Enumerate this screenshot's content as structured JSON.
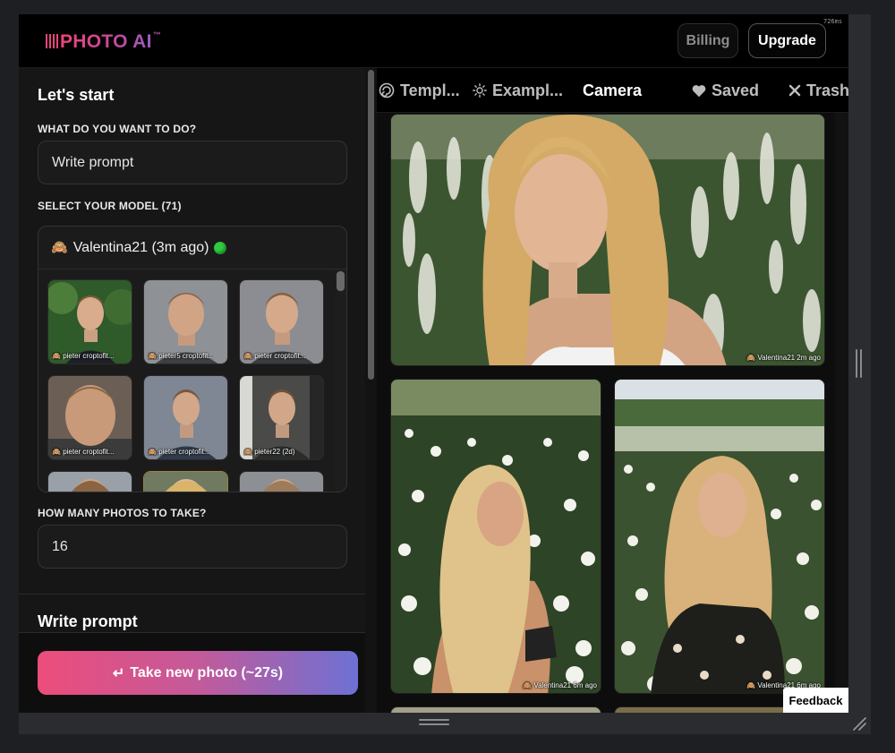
{
  "header": {
    "logo_text": "PHOTO AI",
    "logo_tm": "™",
    "billing_label": "Billing",
    "upgrade_label": "Upgrade",
    "timer": "726ms"
  },
  "left": {
    "title": "Let's start",
    "what_label": "WHAT DO YOU WANT TO DO?",
    "what_value": "Write prompt",
    "model_label": "SELECT YOUR MODEL (71)",
    "selected_model": "Valentina21 (3m ago)",
    "models": [
      {
        "caption": "pieter croptofit..."
      },
      {
        "caption": "pieter5 croptofit..."
      },
      {
        "caption": "pieter croptofit..."
      },
      {
        "caption": "pieter croptofit..."
      },
      {
        "caption": "pieter croptofit..."
      },
      {
        "caption": "pieter22 (2d)"
      }
    ],
    "photos_label": "HOW MANY PHOTOS TO TAKE?",
    "photos_value": "16",
    "write_prompt_title": "Write prompt",
    "take_photo_label": "Take new photo (~27s)",
    "take_photo_icon": "↵"
  },
  "tabs": [
    {
      "label": "Templ...",
      "icon": "spiral-icon"
    },
    {
      "label": "Exampl...",
      "icon": "sun-icon"
    },
    {
      "label": "Camera",
      "icon": "",
      "active": true
    },
    {
      "label": "Saved",
      "icon": "heart-icon"
    },
    {
      "label": "Trash",
      "icon": "x-icon"
    }
  ],
  "gallery": [
    {
      "caption": "Valentina21 2m ago"
    },
    {
      "caption": "Valentina21 6m ago"
    },
    {
      "caption": "Valentina21 6m ago"
    }
  ],
  "feedback_label": "Feedback",
  "colors": {
    "accent_pink": "#ec4d7b",
    "accent_blue": "#6d71d4",
    "status_online": "#2ecc40"
  }
}
